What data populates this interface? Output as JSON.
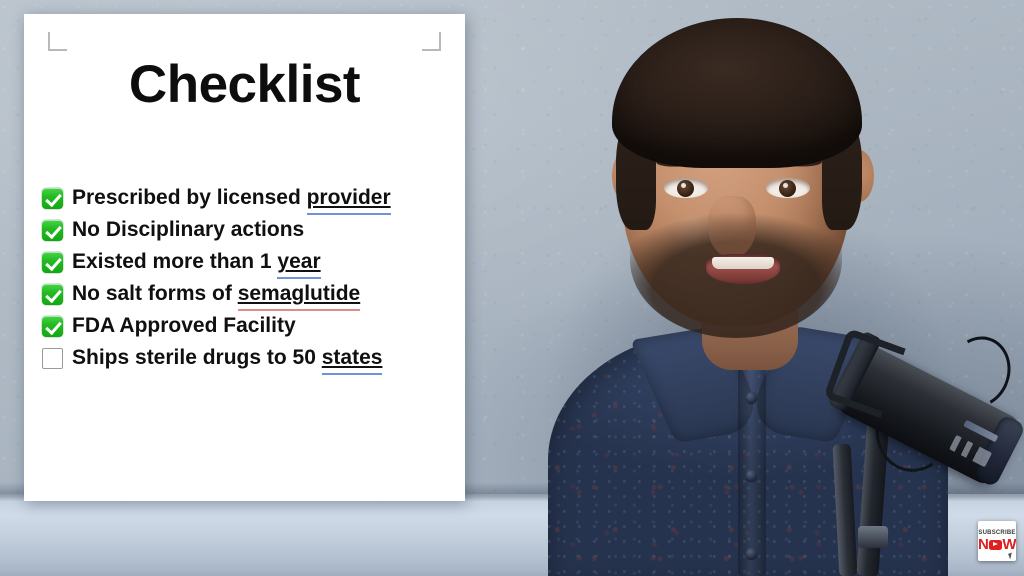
{
  "slide": {
    "title": "Checklist",
    "corner_marks": [
      "top-left",
      "top-right"
    ],
    "items": [
      {
        "checked": true,
        "prefix": "Prescribed by licensed ",
        "marked_word": "provider",
        "suffix": "",
        "underline": "blue",
        "full_text": "Prescribed by licensed provider"
      },
      {
        "checked": true,
        "prefix": "No Disciplinary actions",
        "marked_word": "",
        "suffix": "",
        "underline": "none",
        "full_text": "No Disciplinary actions"
      },
      {
        "checked": true,
        "prefix": "Existed more than 1 ",
        "marked_word": "year",
        "suffix": "",
        "underline": "blue",
        "full_text": "Existed more than 1 year"
      },
      {
        "checked": true,
        "prefix": "No salt forms of ",
        "marked_word": "semaglutide",
        "suffix": "",
        "underline": "red",
        "full_text": "No salt forms of semaglutide"
      },
      {
        "checked": true,
        "prefix": "FDA Approved Facility",
        "marked_word": "",
        "suffix": "",
        "underline": "none",
        "full_text": "FDA Approved Facility"
      },
      {
        "checked": false,
        "prefix": "Ships sterile drugs to 50 ",
        "marked_word": "states",
        "suffix": "",
        "underline": "blue",
        "full_text": "Ships sterile drugs to 50 states"
      }
    ]
  },
  "overlay": {
    "subscribe_top": "SUBSCRIBE",
    "subscribe_n": "N",
    "subscribe_w": "W"
  },
  "colors": {
    "check_green": "#21bb21",
    "unchecked_border": "#9a9a9a",
    "slide_background": "#ffffff",
    "title_text": "#0d0d0d",
    "item_text": "#101010",
    "grammar_underline_blue": "#6f93d6",
    "spelling_underline_red": "#e08b8b",
    "wall": "#aeb9c4",
    "shirt": "#2a3750",
    "subscribe_red": "#e02020",
    "corner_mark": "#b9b9b9"
  },
  "scene": {
    "description": "video-frame-presenter-with-slide"
  }
}
